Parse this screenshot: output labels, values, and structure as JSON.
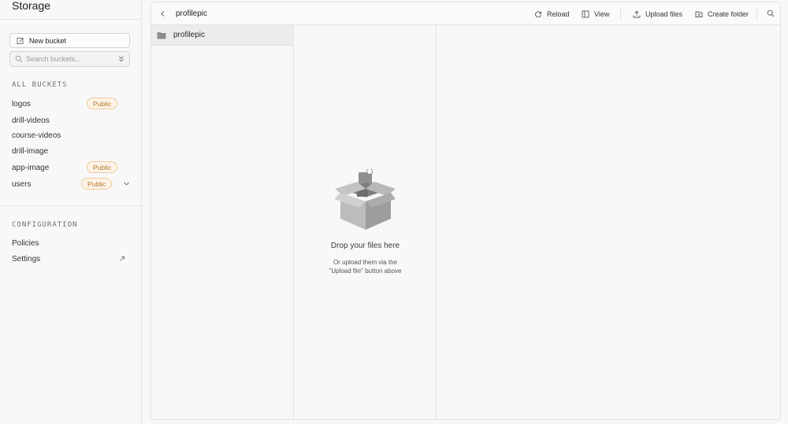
{
  "sidebar": {
    "title": "Storage",
    "new_bucket_label": "New bucket",
    "search_placeholder": "Search buckets...",
    "all_buckets_label": "ALL BUCKETS",
    "buckets": [
      {
        "name": "logos",
        "badge": "Public"
      },
      {
        "name": "drill-videos",
        "badge": ""
      },
      {
        "name": "course-videos",
        "badge": ""
      },
      {
        "name": "drill-image",
        "badge": ""
      },
      {
        "name": "app-image",
        "badge": "Public"
      },
      {
        "name": "users",
        "badge": "Public"
      }
    ],
    "configuration_label": "CONFIGURATION",
    "config_items": [
      {
        "label": "Policies"
      },
      {
        "label": "Settings"
      }
    ]
  },
  "toolbar": {
    "path": "profilepic",
    "reload_label": "Reload",
    "view_label": "View",
    "upload_label": "Upload files",
    "create_folder_label": "Create folder"
  },
  "columns": {
    "folders": [
      {
        "name": "profilepic"
      }
    ]
  },
  "empty_state": {
    "title": "Drop your files here",
    "subtitle_line1": "Or upload them via the",
    "subtitle_line2": "\"Upload file\" button above"
  },
  "colors": {
    "badge_bg": "#fdf3e6",
    "badge_border": "#f0c89a",
    "badge_text": "#b5752e",
    "background": "#f8f8f8",
    "border": "#e2e2e2"
  }
}
